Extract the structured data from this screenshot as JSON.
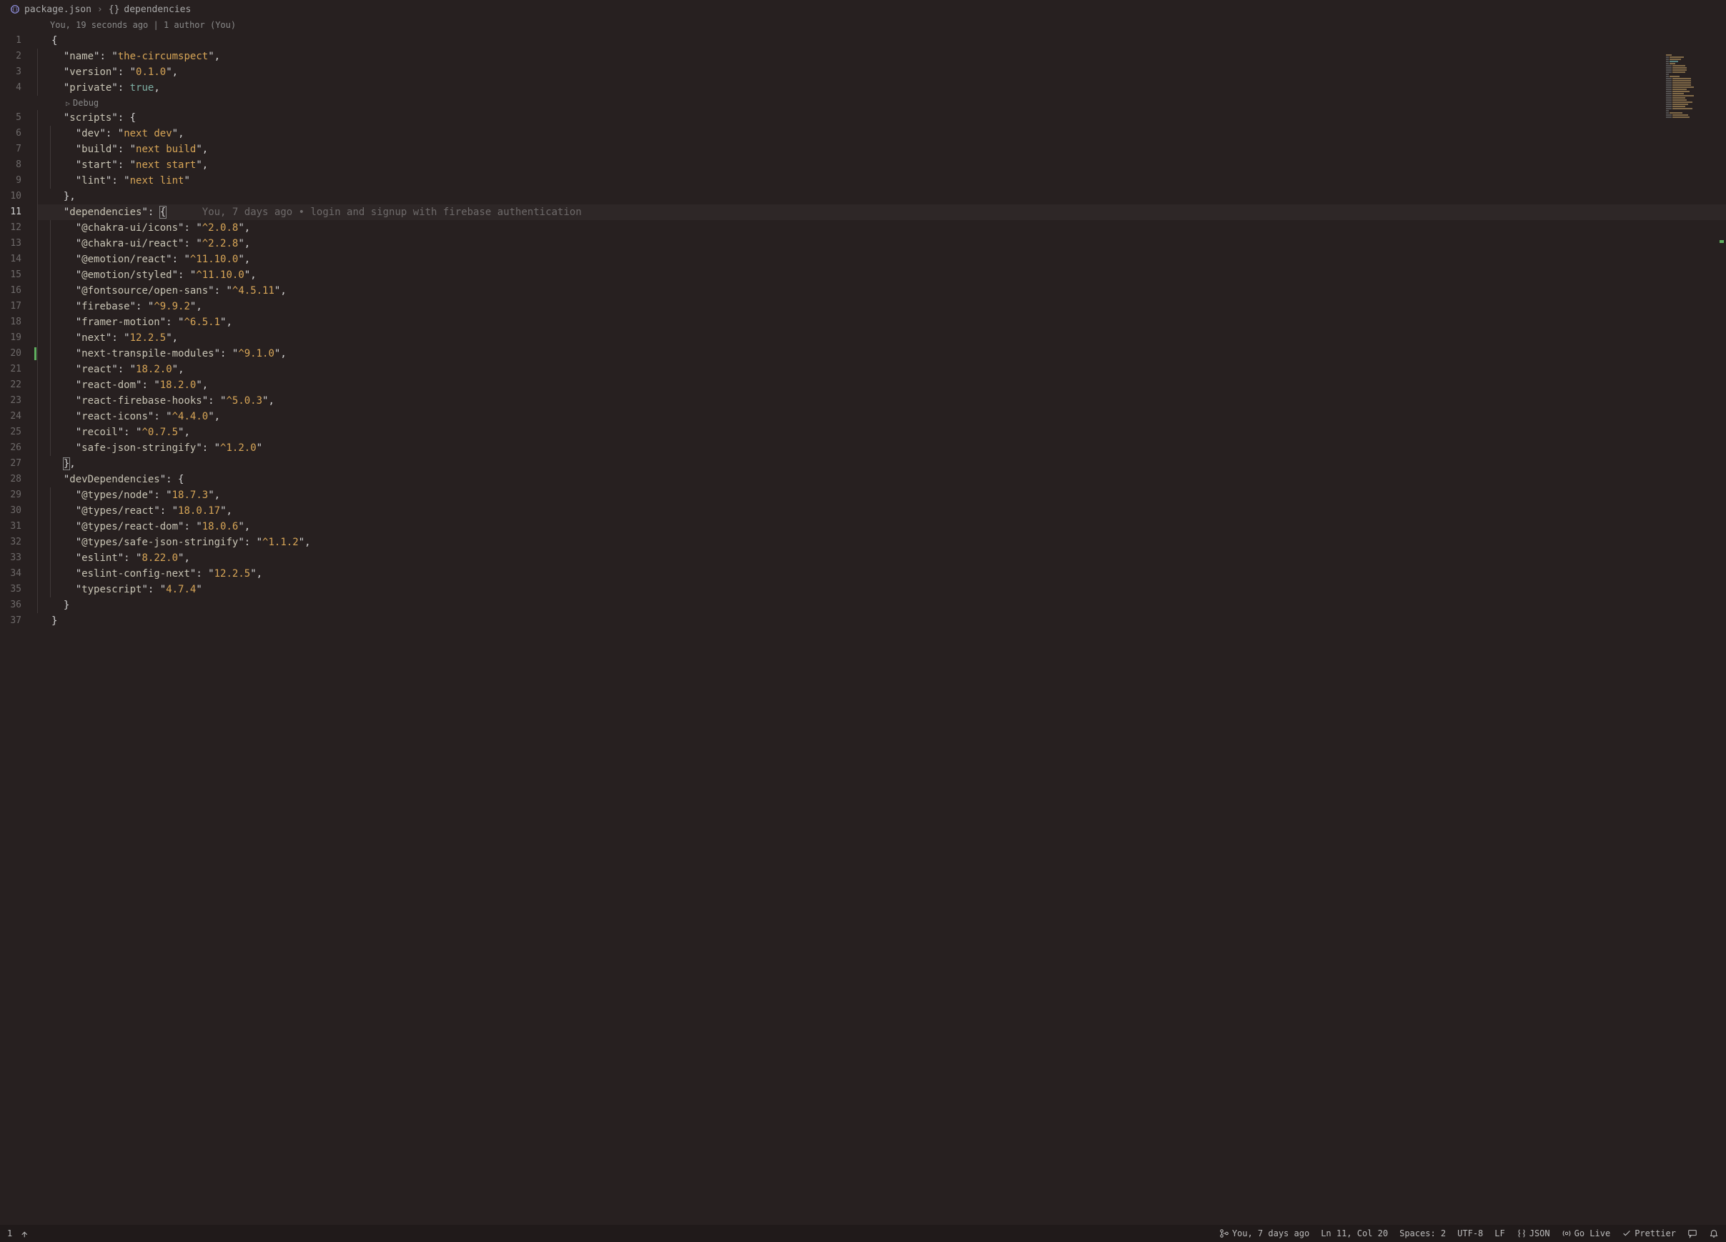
{
  "breadcrumbs": {
    "file_icon": "json-icon",
    "file": "package.json",
    "symbol_icon": "{}",
    "symbol": "dependencies"
  },
  "gitlens_top": "You, 19 seconds ago | 1 author (You)",
  "codelens_debug": "Debug",
  "current_line_blame": "You, 7 days ago • login and signup with firebase authentication",
  "json": {
    "name": "the-circumspect",
    "version": "0.1.0",
    "private": true,
    "scripts": {
      "dev": "next dev",
      "build": "next build",
      "start": "next start",
      "lint": "next lint"
    },
    "dependencies": {
      "@chakra-ui/icons": "^2.0.8",
      "@chakra-ui/react": "^2.2.8",
      "@emotion/react": "^11.10.0",
      "@emotion/styled": "^11.10.0",
      "@fontsource/open-sans": "^4.5.11",
      "firebase": "^9.9.2",
      "framer-motion": "^6.5.1",
      "next": "12.2.5",
      "next-transpile-modules": "^9.1.0",
      "react": "18.2.0",
      "react-dom": "18.2.0",
      "react-firebase-hooks": "^5.0.3",
      "react-icons": "^4.4.0",
      "recoil": "^0.7.5",
      "safe-json-stringify": "^1.2.0"
    },
    "devDependencies": {
      "@types/node": "18.7.3",
      "@types/react": "18.0.17",
      "@types/react-dom": "18.0.6",
      "@types/safe-json-stringify": "^1.1.2",
      "eslint": "8.22.0",
      "eslint-config-next": "12.2.5",
      "typescript": "4.7.4"
    }
  },
  "status": {
    "errors": "1",
    "blame": "You, 7 days ago",
    "cursor": "Ln 11, Col 20",
    "spaces": "Spaces: 2",
    "encoding": "UTF-8",
    "eol": "LF",
    "lang": "JSON",
    "golive": "Go Live",
    "prettier": "Prettier"
  }
}
